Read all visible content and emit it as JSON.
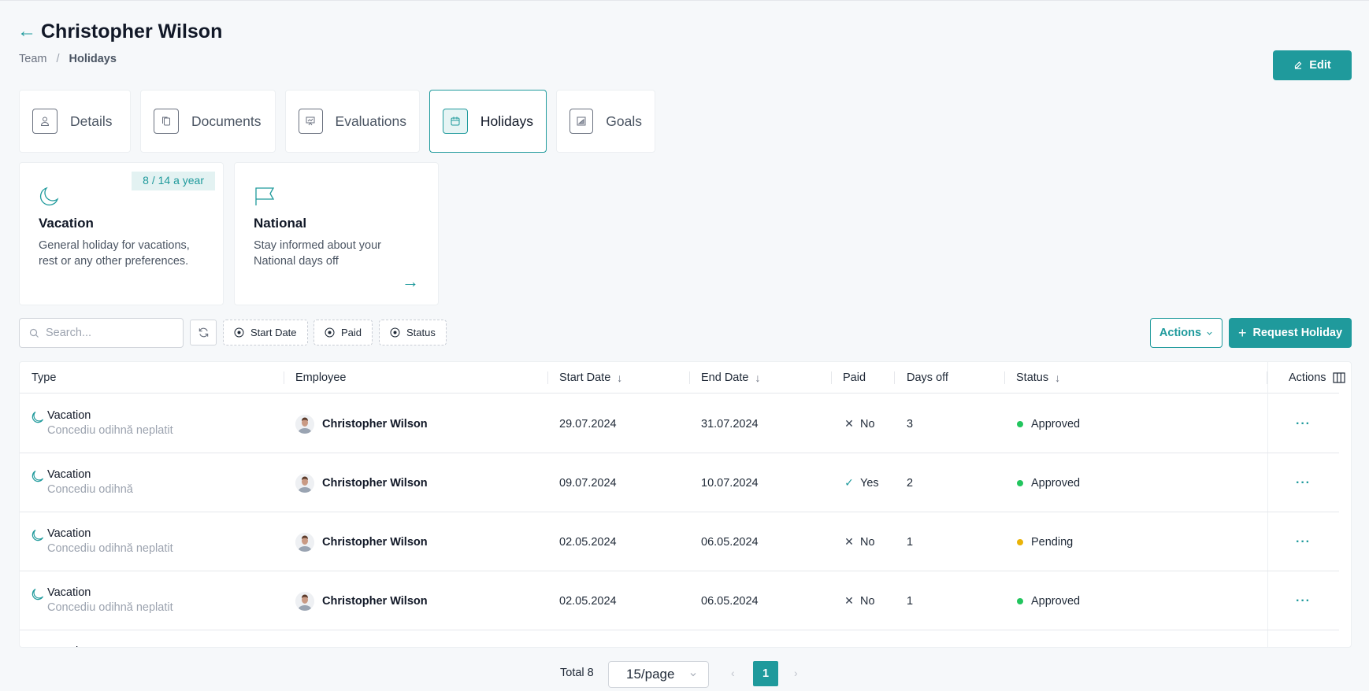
{
  "header": {
    "back_icon": "arrow-left-icon",
    "title": "Christopher Wilson",
    "breadcrumb": [
      {
        "label": "Team"
      },
      {
        "label": "Holidays"
      }
    ],
    "breadcrumb_separator": "/",
    "edit_label": "Edit",
    "edit_icon": "edit-icon"
  },
  "tabs": [
    {
      "label": "Details",
      "icon": "user-icon",
      "active": false
    },
    {
      "label": "Documents",
      "icon": "documents-icon",
      "active": false
    },
    {
      "label": "Evaluations",
      "icon": "presentation-icon",
      "active": false
    },
    {
      "label": "Holidays",
      "icon": "calendar-icon",
      "active": true
    },
    {
      "label": "Goals",
      "icon": "chart-icon",
      "active": false
    }
  ],
  "cards": [
    {
      "icon": "moon-icon",
      "title": "Vacation",
      "description": "General holiday for vacations, rest or any other preferences.",
      "badge": "8 / 14 a year"
    },
    {
      "icon": "flag-icon",
      "title": "National",
      "description": "Stay informed about your National days off",
      "arrow": "→"
    }
  ],
  "toolbar": {
    "search_placeholder": "Search...",
    "search_value": "",
    "filters": [
      {
        "label": "Start Date"
      },
      {
        "label": "Paid"
      },
      {
        "label": "Status"
      }
    ],
    "actions_label": "Actions",
    "request_label": "Request Holiday",
    "request_icon": "+"
  },
  "table": {
    "columns": [
      {
        "label": "Type",
        "sortable": false
      },
      {
        "label": "Employee",
        "sortable": false
      },
      {
        "label": "Start Date",
        "sortable": true
      },
      {
        "label": "End Date",
        "sortable": true
      },
      {
        "label": "Paid",
        "sortable": false
      },
      {
        "label": "Days off",
        "sortable": false
      },
      {
        "label": "Status",
        "sortable": true
      },
      {
        "label": "Actions",
        "sortable": false
      }
    ],
    "sort_glyph": "↓",
    "rows": [
      {
        "type": "Vacation",
        "subtype": "Concediu odihnă neplatit",
        "employee": "Christopher Wilson",
        "start": "29.07.2024",
        "end": "31.07.2024",
        "paid_mark": "✕",
        "paid": "No",
        "days": "3",
        "status": "Approved",
        "status_color": "#22c55e"
      },
      {
        "type": "Vacation",
        "subtype": "Concediu odihnă",
        "employee": "Christopher Wilson",
        "start": "09.07.2024",
        "end": "10.07.2024",
        "paid_mark": "✓",
        "paid": "Yes",
        "days": "2",
        "status": "Approved",
        "status_color": "#22c55e"
      },
      {
        "type": "Vacation",
        "subtype": "Concediu odihnă neplatit",
        "employee": "Christopher Wilson",
        "start": "02.05.2024",
        "end": "06.05.2024",
        "paid_mark": "✕",
        "paid": "No",
        "days": "1",
        "status": "Pending",
        "status_color": "#eab308"
      },
      {
        "type": "Vacation",
        "subtype": "Concediu odihnă neplatit",
        "employee": "Christopher Wilson",
        "start": "02.05.2024",
        "end": "06.05.2024",
        "paid_mark": "✕",
        "paid": "No",
        "days": "1",
        "status": "Approved",
        "status_color": "#22c55e"
      },
      {
        "type": "Vacation",
        "subtype": "",
        "employee": "",
        "start": "",
        "end": "",
        "paid_mark": "",
        "paid": "",
        "days": "",
        "status": "",
        "status_color": ""
      }
    ],
    "more_glyph": "···"
  },
  "pagination": {
    "total": "Total 8",
    "page_size": "15/page",
    "current_page": "1",
    "prev": "‹",
    "next": "›"
  },
  "colors": {
    "accent": "#1f9a9c",
    "approved": "#22c55e",
    "pending": "#eab308"
  }
}
